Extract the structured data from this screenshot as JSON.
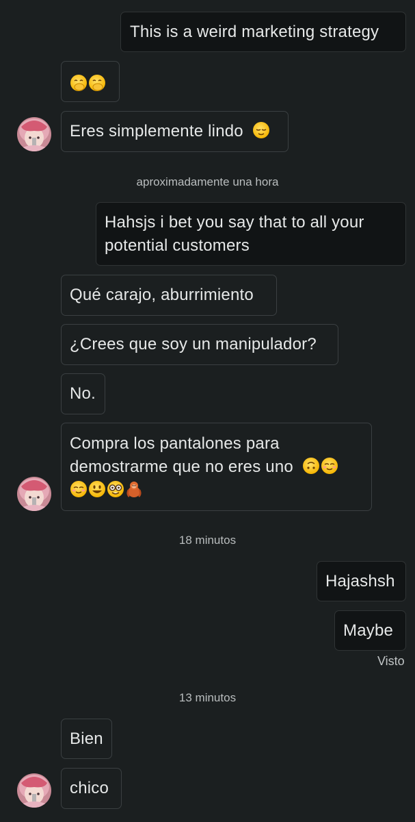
{
  "messages": [
    {
      "id": "m1",
      "from": "me",
      "text": "This is a weird marketing strategy",
      "emoji": []
    },
    {
      "id": "m2",
      "from": "them",
      "text": "",
      "emoji": [
        "face-with-hand-over-mouth",
        "face-with-hand-over-mouth"
      ]
    },
    {
      "id": "m3",
      "from": "them",
      "text": "Eres simplemente lindo",
      "emoji": [
        "relieved-face"
      ]
    },
    {
      "id": "m4",
      "from": "me",
      "text": "Hahsjs i bet you say that to all your potential customers",
      "emoji": []
    },
    {
      "id": "m5",
      "from": "them",
      "text": "Qué carajo, aburrimiento",
      "emoji": []
    },
    {
      "id": "m6",
      "from": "them",
      "text": "¿Crees que soy un manipulador?",
      "emoji": []
    },
    {
      "id": "m7",
      "from": "them",
      "text": "No.",
      "emoji": []
    },
    {
      "id": "m8",
      "from": "them",
      "text_line1": "Compra los pantalones para",
      "text_line2": "demostrarme que no eres uno",
      "emoji_line2": [
        "upside-down-face",
        "smiling-face"
      ],
      "emoji_line3": [
        "smiling-face",
        "grinning-face",
        "nerd-face",
        "orangutan"
      ]
    },
    {
      "id": "m9",
      "from": "me",
      "text": "Hajashsh",
      "emoji": []
    },
    {
      "id": "m10",
      "from": "me",
      "text": "Maybe",
      "emoji": []
    },
    {
      "id": "m11",
      "from": "them",
      "text": "Bien",
      "emoji": []
    },
    {
      "id": "m12",
      "from": "them",
      "text": "chico",
      "emoji": []
    }
  ],
  "timestamps": {
    "t1": "aproximadamente una hora",
    "t2": "18 minutos",
    "t3": "13 minutos"
  },
  "status": {
    "seen": "Visto"
  },
  "colors": {
    "background": "#1b1f20",
    "bubble_border": "#3b4042",
    "text": "#e6e8e8"
  }
}
